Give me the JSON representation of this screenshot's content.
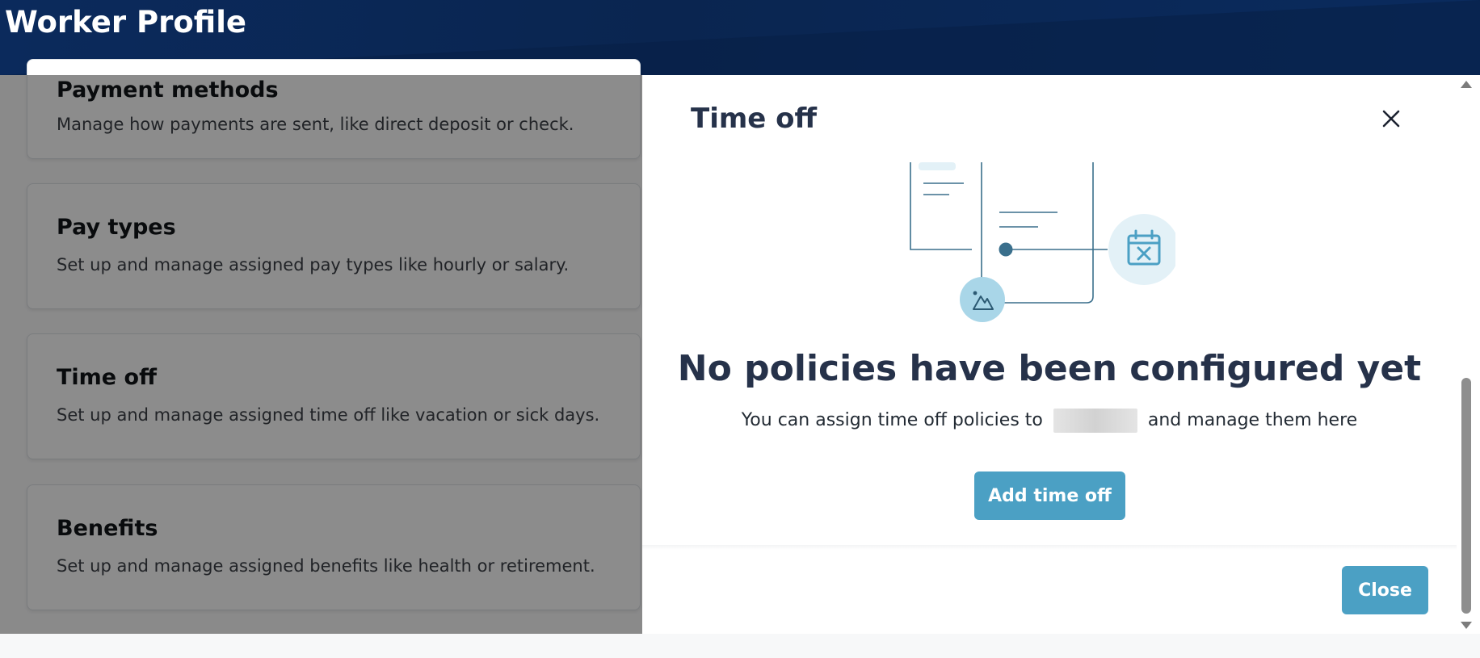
{
  "header": {
    "title": "Worker Profile"
  },
  "cards": [
    {
      "title": "Payment methods",
      "description": "Manage how payments are sent, like direct deposit or check."
    },
    {
      "title": "Pay types",
      "description": "Set up and manage assigned pay types like hourly or salary."
    },
    {
      "title": "Time off",
      "description": "Set up and manage assigned time off like vacation or sick days."
    },
    {
      "title": "Benefits",
      "description": "Set up and manage assigned benefits like health or retirement."
    }
  ],
  "modal": {
    "title": "Time off",
    "empty_heading": "No policies have been configured yet",
    "empty_sub_before": "You can assign time off policies to",
    "empty_sub_after": "and manage them here",
    "add_button": "Add time off",
    "close_button": "Close"
  },
  "icons": {
    "close": "close-icon",
    "calendar": "calendar-x-icon",
    "image": "image-mountain-icon"
  },
  "colors": {
    "header_bg": "#0a2b5e",
    "accent": "#4ba0c4",
    "heading_text": "#26324a",
    "icon_circle": "#a9d6e8"
  }
}
